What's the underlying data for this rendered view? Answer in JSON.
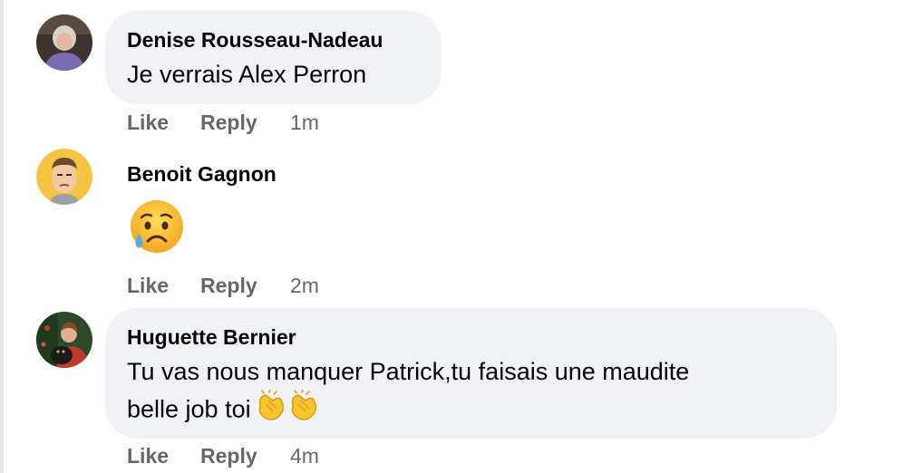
{
  "comments": [
    {
      "author": "Denise Rousseau-Nadeau",
      "text": "Je verrais Alex Perron",
      "like_label": "Like",
      "reply_label": "Reply",
      "time": "1m",
      "avatar": "photo-avatar"
    },
    {
      "author": "Benoit Gagnon",
      "text": "",
      "emoji": "crying-face-emoji",
      "like_label": "Like",
      "reply_label": "Reply",
      "time": "2m",
      "avatar": "cartoon-avatar"
    },
    {
      "author": "Huguette Bernier",
      "text_line1": "Tu vas nous manquer Patrick,tu faisais une maudite",
      "text_line2": "belle job toi",
      "emoji": "clapping-hands-emoji",
      "like_label": "Like",
      "reply_label": "Reply",
      "time": "4m",
      "avatar": "photo-avatar"
    }
  ],
  "colors": {
    "bubble": "#f0f2f5",
    "meta_text": "#65676b",
    "primary_text": "#050505"
  }
}
